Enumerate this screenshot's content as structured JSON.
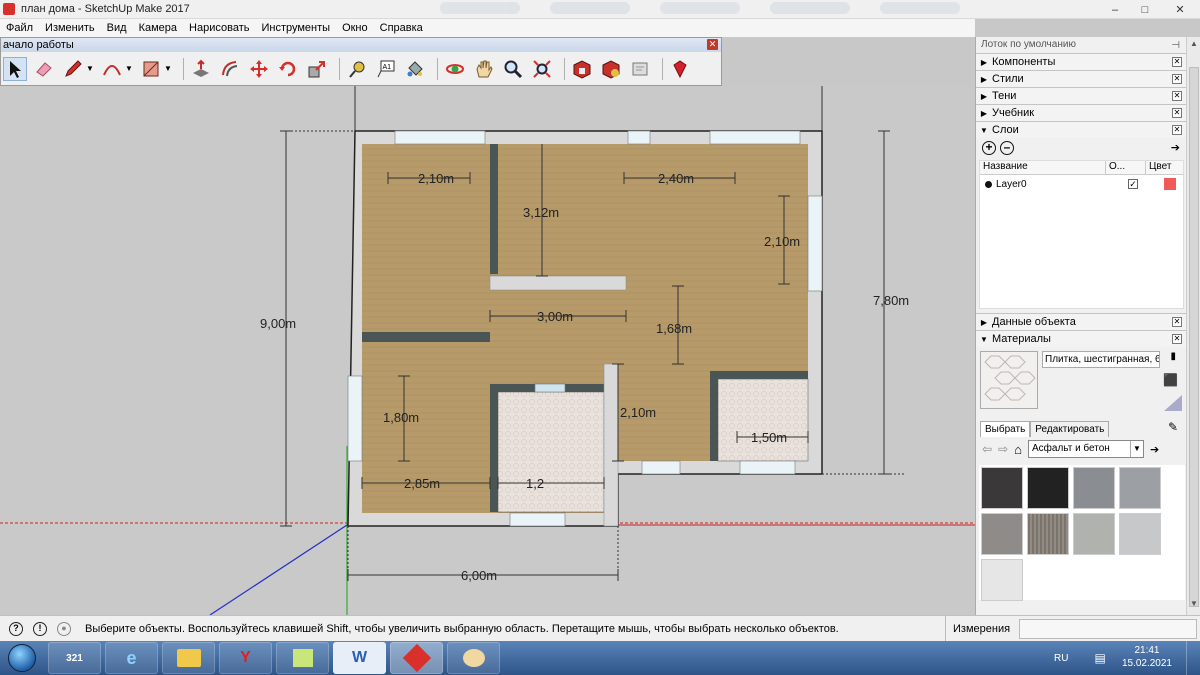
{
  "window": {
    "title": "план дома - SketchUp Make 2017",
    "controls": [
      "–",
      "□",
      "✕"
    ]
  },
  "menu": [
    "Файл",
    "Изменить",
    "Вид",
    "Камера",
    "Нарисовать",
    "Инструменты",
    "Окно",
    "Справка"
  ],
  "toolbar": {
    "title": "ачало работы",
    "close": "✕",
    "tools": [
      {
        "name": "select-icon",
        "selected": true
      },
      {
        "name": "eraser-icon"
      },
      {
        "name": "pencil-icon",
        "dropdown": true
      },
      {
        "name": "arc-icon",
        "dropdown": true
      },
      {
        "name": "rectangle-icon",
        "dropdown": true
      },
      {
        "name": "push-pull-icon"
      },
      {
        "name": "offset-icon"
      },
      {
        "name": "move-icon"
      },
      {
        "name": "rotate-icon"
      },
      {
        "name": "scale-icon"
      },
      {
        "name": "tape-measure-icon"
      },
      {
        "name": "text-icon",
        "text": "A1"
      },
      {
        "name": "paint-bucket-icon"
      },
      {
        "name": "orbit-icon"
      },
      {
        "name": "pan-icon"
      },
      {
        "name": "zoom-icon"
      },
      {
        "name": "zoom-extents-icon"
      },
      {
        "name": "warehouse-icon"
      },
      {
        "name": "share-model-icon"
      },
      {
        "name": "extension-warehouse-icon"
      },
      {
        "name": "ruby-icon"
      }
    ]
  },
  "drawing": {
    "dimensions": [
      "2,10m",
      "2,40m",
      "3,12m",
      "2,10m",
      "3,00m",
      "1,68m",
      "9,00m",
      "7,80m",
      "1,80m",
      "2,10m",
      "1,50m",
      "2,85m",
      "1,2",
      "6,00m"
    ],
    "colors": {
      "floor": "#b79a6a",
      "wall": "#d9d9d9",
      "inner_wall": "#4a5656",
      "tile": "#e9e2dc",
      "axis_red": "#d42020",
      "axis_green": "#1aa31a",
      "axis_blue": "#2030c8"
    }
  },
  "tray": {
    "title": "Лоток по умолчанию",
    "pin": "⊣",
    "sections": {
      "components": "Компоненты",
      "styles": "Стили",
      "shadows": "Тени",
      "tutorial": "Учебник",
      "layers": "Слои",
      "entity_info": "Данные объекта",
      "materials": "Материалы"
    },
    "layers": {
      "add": "+",
      "remove": "–",
      "headers": [
        "Название",
        "О...",
        "Цвет"
      ],
      "rows": [
        {
          "name": "Layer0",
          "visible": true,
          "color": "#f05a5a"
        }
      ]
    },
    "materials": {
      "current": "Плитка, шестигранная, 6",
      "tab_select": "Выбрать",
      "tab_edit": "Редактировать",
      "library": "Асфальт и бетон",
      "swatches": [
        "#3a3838",
        "#222222",
        "#8a8e92",
        "#9c9fa3",
        "#8f8b88",
        "#7a746c",
        "#b0b2ae",
        "#c6c8ca",
        "#e6e6e6"
      ]
    }
  },
  "status": {
    "text": "Выберите объекты. Воспользуйтесь клавишей Shift, чтобы увеличить выбранную область. Перетащите мышь, чтобы выбрать несколько объектов.",
    "measurements_label": "Измерения",
    "measurements_value": ""
  },
  "taskbar": {
    "buttons": [
      {
        "name": "calendar-app",
        "label": "321"
      },
      {
        "name": "internet-explorer",
        "label": "e"
      },
      {
        "name": "file-explorer",
        "label": ""
      },
      {
        "name": "yandex-browser",
        "label": "Y"
      },
      {
        "name": "sticky-notes",
        "label": ""
      },
      {
        "name": "word",
        "label": "W"
      },
      {
        "name": "sketchup",
        "label": ""
      },
      {
        "name": "paint",
        "label": ""
      }
    ],
    "lang": "RU",
    "time": "21:41",
    "date": "15.02.2021"
  }
}
